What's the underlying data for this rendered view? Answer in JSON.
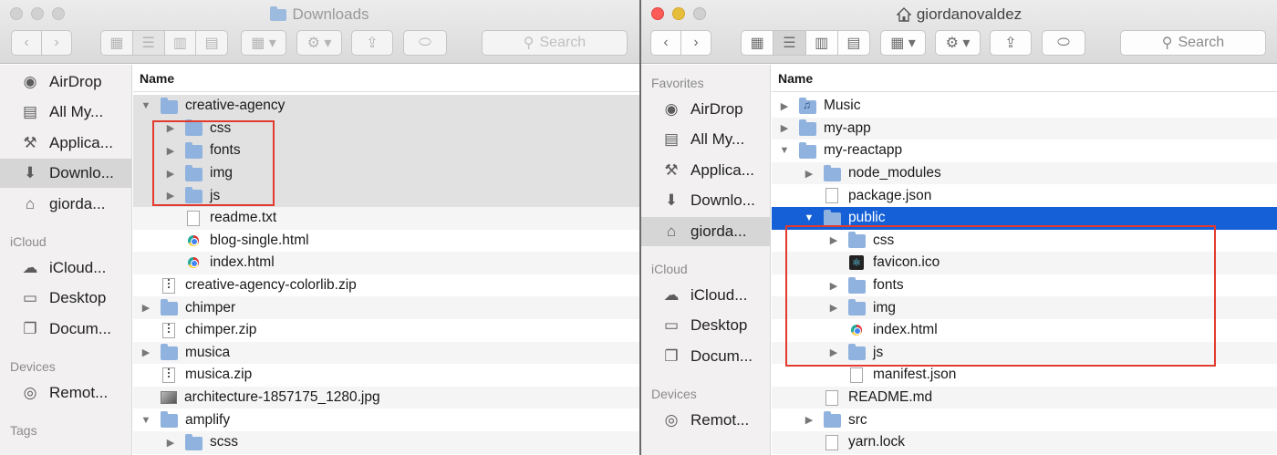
{
  "left_window": {
    "title": "Downloads",
    "search_placeholder": "Search",
    "column_name": "Name",
    "sidebar": {
      "items_top": [
        {
          "label": "AirDrop",
          "icon": "airdrop-icon"
        },
        {
          "label": "All My...",
          "icon": "all-my-files-icon"
        },
        {
          "label": "Applica...",
          "icon": "applications-icon"
        },
        {
          "label": "Downlo...",
          "icon": "downloads-icon",
          "selected": true
        },
        {
          "label": "giorda...",
          "icon": "home-icon"
        }
      ],
      "icloud_header": "iCloud",
      "icloud_items": [
        {
          "label": "iCloud...",
          "icon": "cloud-icon"
        },
        {
          "label": "Desktop",
          "icon": "desktop-icon"
        },
        {
          "label": "Docum...",
          "icon": "documents-icon"
        }
      ],
      "devices_header": "Devices",
      "device_items": [
        {
          "label": "Remot...",
          "icon": "disc-icon"
        }
      ],
      "tags_header": "Tags"
    },
    "files": [
      {
        "name": "creative-agency",
        "kind": "folder",
        "level": 0,
        "expanded": true
      },
      {
        "name": "css",
        "kind": "folder",
        "level": 1
      },
      {
        "name": "fonts",
        "kind": "folder",
        "level": 1
      },
      {
        "name": "img",
        "kind": "folder",
        "level": 1
      },
      {
        "name": "js",
        "kind": "folder",
        "level": 1
      },
      {
        "name": "readme.txt",
        "kind": "doc",
        "level": 1
      },
      {
        "name": "blog-single.html",
        "kind": "html",
        "level": 1
      },
      {
        "name": "index.html",
        "kind": "html",
        "level": 1
      },
      {
        "name": "creative-agency-colorlib.zip",
        "kind": "zip",
        "level": 0
      },
      {
        "name": "chimper",
        "kind": "folder",
        "level": 0
      },
      {
        "name": "chimper.zip",
        "kind": "zip",
        "level": 0
      },
      {
        "name": "musica",
        "kind": "folder",
        "level": 0
      },
      {
        "name": "musica.zip",
        "kind": "zip",
        "level": 0
      },
      {
        "name": "architecture-1857175_1280.jpg",
        "kind": "img",
        "level": 0
      },
      {
        "name": "amplify",
        "kind": "folder",
        "level": 0,
        "expanded": true
      },
      {
        "name": "scss",
        "kind": "folder",
        "level": 1
      }
    ]
  },
  "right_window": {
    "title": "giordanovaldez",
    "search_placeholder": "Search",
    "column_name": "Name",
    "sidebar": {
      "favorites_header": "Favorites",
      "items_top": [
        {
          "label": "AirDrop",
          "icon": "airdrop-icon"
        },
        {
          "label": "All My...",
          "icon": "all-my-files-icon"
        },
        {
          "label": "Applica...",
          "icon": "applications-icon"
        },
        {
          "label": "Downlo...",
          "icon": "downloads-icon"
        },
        {
          "label": "giorda...",
          "icon": "home-icon",
          "selected": true
        }
      ],
      "icloud_header": "iCloud",
      "icloud_items": [
        {
          "label": "iCloud...",
          "icon": "cloud-icon"
        },
        {
          "label": "Desktop",
          "icon": "desktop-icon"
        },
        {
          "label": "Docum...",
          "icon": "documents-icon"
        }
      ],
      "devices_header": "Devices",
      "device_items": [
        {
          "label": "Remot...",
          "icon": "disc-icon"
        }
      ]
    },
    "files": [
      {
        "name": "Music",
        "kind": "music",
        "level": 0
      },
      {
        "name": "my-app",
        "kind": "folder",
        "level": 0
      },
      {
        "name": "my-reactapp",
        "kind": "folder",
        "level": 0,
        "expanded": true
      },
      {
        "name": "node_modules",
        "kind": "folder",
        "level": 1
      },
      {
        "name": "package.json",
        "kind": "doc",
        "level": 1
      },
      {
        "name": "public",
        "kind": "folder",
        "level": 1,
        "expanded": true,
        "selected": true
      },
      {
        "name": "css",
        "kind": "folder",
        "level": 2
      },
      {
        "name": "favicon.ico",
        "kind": "react",
        "level": 2
      },
      {
        "name": "fonts",
        "kind": "folder",
        "level": 2
      },
      {
        "name": "img",
        "kind": "folder",
        "level": 2
      },
      {
        "name": "index.html",
        "kind": "html",
        "level": 2
      },
      {
        "name": "js",
        "kind": "folder",
        "level": 2
      },
      {
        "name": "manifest.json",
        "kind": "doc",
        "level": 2
      },
      {
        "name": "README.md",
        "kind": "doc",
        "level": 1
      },
      {
        "name": "src",
        "kind": "folder",
        "level": 1
      },
      {
        "name": "yarn.lock",
        "kind": "doc",
        "level": 1
      }
    ]
  },
  "colors": {
    "selection": "#1560d6",
    "highlight_box": "#e23a2e",
    "folder": "#8fb2de"
  }
}
